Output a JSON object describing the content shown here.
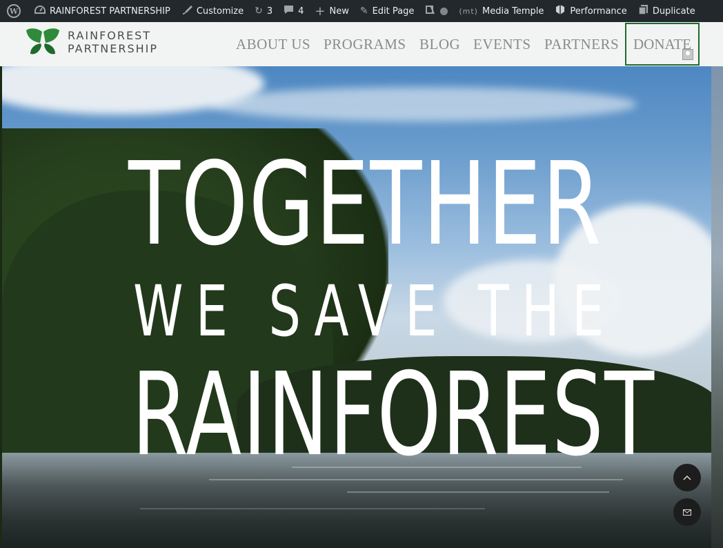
{
  "adminbar": {
    "site_name": "RAINFOREST PARTNERSHIP",
    "customize": "Customize",
    "updates_count": "3",
    "comments_count": "4",
    "new_label": "New",
    "edit_page": "Edit Page",
    "mt_logo": "(mt)",
    "media_temple": "Media Temple",
    "performance": "Performance",
    "duplicate": "Duplicate"
  },
  "header": {
    "logo_line1": "RAINFOREST",
    "logo_line2": "PARTNERSHIP",
    "nav": [
      "ABOUT US",
      "PROGRAMS",
      "BLOG",
      "EVENTS",
      "PARTNERS"
    ],
    "donate": "DONATE"
  },
  "hero": {
    "line1": "TOGETHER",
    "line2": "WE SAVE THE",
    "line3": "RAINFOREST"
  },
  "colors": {
    "adminbar_bg": "#23282d",
    "header_bg": "#f2f3f3",
    "donate_border": "#1f6b2f",
    "logo_green": "#2f8a3a"
  },
  "icons": {
    "scroll_top": "chevron-up-icon",
    "contact": "envelope-icon"
  }
}
